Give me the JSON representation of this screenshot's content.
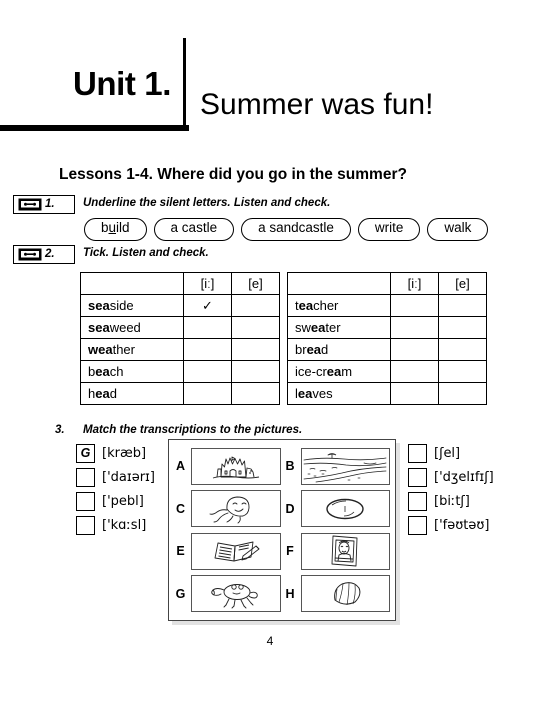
{
  "header": {
    "unit_label": "Unit 1.",
    "subtitle": "Summer was fun!"
  },
  "lessons_heading": "Lessons 1-4. Where did you go in the summer?",
  "exercises": [
    {
      "number": "1.",
      "icon": "cassette-icon",
      "instruction": "Underline the silent letters. Listen and check.",
      "words": [
        {
          "before": "b",
          "underlined": "u",
          "after": "ild"
        },
        {
          "before": "a castle",
          "underlined": "",
          "after": ""
        },
        {
          "before": "a sandcastle",
          "underlined": "",
          "after": ""
        },
        {
          "before": "write",
          "underlined": "",
          "after": ""
        },
        {
          "before": "walk",
          "underlined": "",
          "after": ""
        }
      ]
    },
    {
      "number": "2.",
      "icon": "cassette-icon",
      "instruction": "Tick. Listen and check.",
      "columns": [
        "",
        "[iː]",
        "[e]"
      ],
      "table_left": [
        {
          "bold": "sea",
          "rest": "side",
          "i_mark": "✓",
          "e_mark": ""
        },
        {
          "bold": "sea",
          "rest": "weed",
          "i_mark": "",
          "e_mark": ""
        },
        {
          "bold": "wea",
          "rest": "ther",
          "i_mark": "",
          "e_mark": ""
        },
        {
          "bold": "",
          "rest": "",
          "i_mark": "",
          "e_mark": "",
          "pre": "b",
          "mid": "ea",
          "post": "ch"
        },
        {
          "bold": "",
          "rest": "",
          "i_mark": "",
          "e_mark": "",
          "pre": "h",
          "mid": "ea",
          "post": "d"
        }
      ],
      "table_right": [
        {
          "pre": "t",
          "mid": "ea",
          "post": "cher",
          "i_mark": "",
          "e_mark": ""
        },
        {
          "pre": "sw",
          "mid": "ea",
          "post": "ter",
          "i_mark": "",
          "e_mark": ""
        },
        {
          "pre": "br",
          "mid": "ea",
          "post": "d",
          "i_mark": "",
          "e_mark": ""
        },
        {
          "pre": "ice-cr",
          "mid": "ea",
          "post": "m",
          "i_mark": "",
          "e_mark": ""
        },
        {
          "pre": "l",
          "mid": "ea",
          "post": "ves",
          "i_mark": "",
          "e_mark": ""
        }
      ]
    },
    {
      "number": "3.",
      "instruction": "Match the transcriptions to the pictures.",
      "transcriptions_left": [
        {
          "answer": "G",
          "text": "[kræb]"
        },
        {
          "answer": "",
          "text": "['daɪərɪ]"
        },
        {
          "answer": "",
          "text": "['pebl]"
        },
        {
          "answer": "",
          "text": "['kɑːsl]"
        }
      ],
      "transcriptions_right": [
        {
          "answer": "",
          "text": "[ʃel]"
        },
        {
          "answer": "",
          "text": "['dʒelɪfɪʃ]"
        },
        {
          "answer": "",
          "text": "[biːtʃ]"
        },
        {
          "answer": "",
          "text": "['fəʊtəʊ]"
        }
      ],
      "pictures": [
        {
          "letter": "A",
          "icon": "sandcastle-icon"
        },
        {
          "letter": "B",
          "icon": "beach-icon"
        },
        {
          "letter": "C",
          "icon": "jellyfish-icon"
        },
        {
          "letter": "D",
          "icon": "pebble-icon"
        },
        {
          "letter": "E",
          "icon": "diary-icon"
        },
        {
          "letter": "F",
          "icon": "photo-icon"
        },
        {
          "letter": "G",
          "icon": "crab-icon"
        },
        {
          "letter": "H",
          "icon": "shell-icon"
        }
      ]
    }
  ],
  "page_number": "4",
  "colors": {
    "ink": "#000000",
    "paper": "#ffffff",
    "shadow": "#e2e2e2",
    "frame": "#555555"
  }
}
